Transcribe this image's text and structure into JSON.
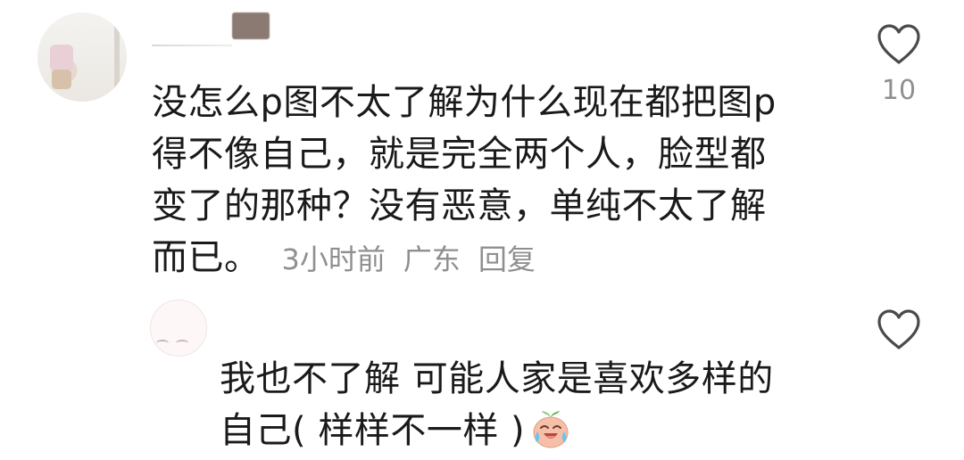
{
  "comments": [
    {
      "text_lines": [
        "没怎么p图不太了解为什么现在都把图p",
        "得不像自己，就是完全两个人，脸型都",
        "变了的那种？没有恶意，单纯不太了解",
        "而已。"
      ],
      "time": "3小时前",
      "location": "广东",
      "reply_label": "回复",
      "like_icon": "heart-outline-icon",
      "like_count": "10"
    },
    {
      "text_lines": [
        "我也不了解 可能人家是喜欢多样的",
        "自己( 样样不一样 )"
      ],
      "emoji": "laughing-crying-emoji",
      "like_icon": "heart-outline-icon"
    }
  ],
  "colors": {
    "text": "#1a1a1a",
    "meta": "#8f8f8f",
    "icon": "#4a4a4a",
    "background": "#ffffff"
  }
}
